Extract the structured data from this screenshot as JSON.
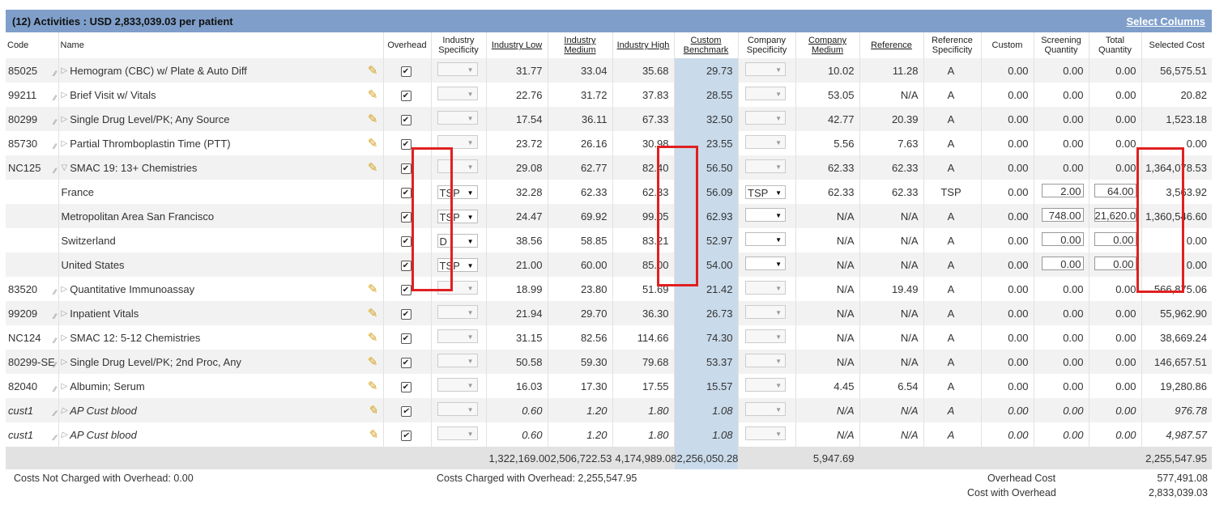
{
  "title": "(12) Activities : USD 2,833,039.03 per patient",
  "select_columns": "Select Columns",
  "columns": [
    "Code",
    "Name",
    "Overhead",
    "Industry Specificity",
    "Industry Low",
    "Industry Medium",
    "Industry High",
    "Custom Benchmark",
    "Company Specificity",
    "Company Medium",
    "Reference",
    "Reference Specificity",
    "Custom",
    "Screening Quantity",
    "Total Quantity",
    "Selected Cost"
  ],
  "rows": [
    {
      "code": "85025",
      "name": "Hemogram (CBC) w/ Plate & Auto Diff",
      "ind_spec": "",
      "low": "31.77",
      "med": "33.04",
      "high": "35.68",
      "bench": "29.73",
      "comp_spec": "",
      "comp_med": "10.02",
      "ref": "11.28",
      "ref_spec": "A",
      "custom": "0.00",
      "screen": "0.00",
      "total": "0.00",
      "cost": "56,575.51"
    },
    {
      "code": "99211",
      "name": "Brief Visit w/ Vitals",
      "ind_spec": "",
      "low": "22.76",
      "med": "31.72",
      "high": "37.83",
      "bench": "28.55",
      "comp_spec": "",
      "comp_med": "53.05",
      "ref": "N/A",
      "ref_spec": "A",
      "custom": "0.00",
      "screen": "0.00",
      "total": "0.00",
      "cost": "20.82"
    },
    {
      "code": "80299",
      "name": "Single Drug Level/PK; Any Source",
      "ind_spec": "",
      "low": "17.54",
      "med": "36.11",
      "high": "67.33",
      "bench": "32.50",
      "comp_spec": "",
      "comp_med": "42.77",
      "ref": "20.39",
      "ref_spec": "A",
      "custom": "0.00",
      "screen": "0.00",
      "total": "0.00",
      "cost": "1,523.18"
    },
    {
      "code": "85730",
      "name": "Partial Thromboplastin Time (PTT)",
      "ind_spec": "",
      "low": "23.72",
      "med": "26.16",
      "high": "30.98",
      "bench": "23.55",
      "comp_spec": "",
      "comp_med": "5.56",
      "ref": "7.63",
      "ref_spec": "A",
      "custom": "0.00",
      "screen": "0.00",
      "total": "0.00",
      "cost": "0.00"
    },
    {
      "code": "NC125",
      "name": "SMAC 19: 13+ Chemistries",
      "ind_spec": "",
      "low": "29.08",
      "med": "62.77",
      "high": "82.40",
      "bench": "56.50",
      "comp_spec": "",
      "comp_med": "62.33",
      "ref": "62.33",
      "ref_spec": "A",
      "custom": "0.00",
      "screen": "0.00",
      "total": "0.00",
      "cost": "1,364,078.53"
    },
    {
      "code": "",
      "name": "France",
      "ind_spec": "TSP",
      "low": "32.28",
      "med": "62.33",
      "high": "62.33",
      "bench": "56.09",
      "comp_spec": "TSP",
      "comp_med": "62.33",
      "ref": "62.33",
      "ref_spec": "TSP",
      "custom": "0.00",
      "screen": "2.00",
      "total": "64.00",
      "cost": "3,563.92"
    },
    {
      "code": "",
      "name": "Metropolitan Area San Francisco",
      "ind_spec": "TSP",
      "low": "24.47",
      "med": "69.92",
      "high": "99.05",
      "bench": "62.93",
      "comp_spec": "",
      "comp_med": "N/A",
      "ref": "N/A",
      "ref_spec": "A",
      "custom": "0.00",
      "screen": "748.00",
      "total": "21,620.0",
      "cost": "1,360,546.60"
    },
    {
      "code": "",
      "name": "Switzerland",
      "ind_spec": "D",
      "low": "38.56",
      "med": "58.85",
      "high": "83.21",
      "bench": "52.97",
      "comp_spec": "",
      "comp_med": "N/A",
      "ref": "N/A",
      "ref_spec": "A",
      "custom": "0.00",
      "screen": "0.00",
      "total": "0.00",
      "cost": "0.00"
    },
    {
      "code": "",
      "name": "United States",
      "ind_spec": "TSP",
      "low": "21.00",
      "med": "60.00",
      "high": "85.00",
      "bench": "54.00",
      "comp_spec": "",
      "comp_med": "N/A",
      "ref": "N/A",
      "ref_spec": "A",
      "custom": "0.00",
      "screen": "0.00",
      "total": "0.00",
      "cost": "0.00"
    },
    {
      "code": "83520",
      "name": "Quantitative Immunoassay",
      "ind_spec": "",
      "low": "18.99",
      "med": "23.80",
      "high": "51.69",
      "bench": "21.42",
      "comp_spec": "",
      "comp_med": "N/A",
      "ref": "19.49",
      "ref_spec": "A",
      "custom": "0.00",
      "screen": "0.00",
      "total": "0.00",
      "cost": "566,875.06"
    },
    {
      "code": "99209",
      "name": "Inpatient Vitals",
      "ind_spec": "",
      "low": "21.94",
      "med": "29.70",
      "high": "36.30",
      "bench": "26.73",
      "comp_spec": "",
      "comp_med": "N/A",
      "ref": "N/A",
      "ref_spec": "A",
      "custom": "0.00",
      "screen": "0.00",
      "total": "0.00",
      "cost": "55,962.90"
    },
    {
      "code": "NC124",
      "name": "SMAC 12: 5-12 Chemistries",
      "ind_spec": "",
      "low": "31.15",
      "med": "82.56",
      "high": "114.66",
      "bench": "74.30",
      "comp_spec": "",
      "comp_med": "N/A",
      "ref": "N/A",
      "ref_spec": "A",
      "custom": "0.00",
      "screen": "0.00",
      "total": "0.00",
      "cost": "38,669.24"
    },
    {
      "code": "80299-SE",
      "name": "Single Drug Level/PK; 2nd Proc, Any",
      "ind_spec": "",
      "low": "50.58",
      "med": "59.30",
      "high": "79.68",
      "bench": "53.37",
      "comp_spec": "",
      "comp_med": "N/A",
      "ref": "N/A",
      "ref_spec": "A",
      "custom": "0.00",
      "screen": "0.00",
      "total": "0.00",
      "cost": "146,657.51"
    },
    {
      "code": "82040",
      "name": "Albumin; Serum",
      "ind_spec": "",
      "low": "16.03",
      "med": "17.30",
      "high": "17.55",
      "bench": "15.57",
      "comp_spec": "",
      "comp_med": "4.45",
      "ref": "6.54",
      "ref_spec": "A",
      "custom": "0.00",
      "screen": "0.00",
      "total": "0.00",
      "cost": "19,280.86"
    },
    {
      "code": "cust1",
      "name": "AP Cust blood",
      "ind_spec": "",
      "low": "0.60",
      "med": "1.20",
      "high": "1.80",
      "bench": "1.08",
      "comp_spec": "",
      "comp_med": "N/A",
      "ref": "N/A",
      "ref_spec": "A",
      "custom": "0.00",
      "screen": "0.00",
      "total": "0.00",
      "cost": "976.78"
    },
    {
      "code": "cust1",
      "name": "AP Cust blood",
      "ind_spec": "",
      "low": "0.60",
      "med": "1.20",
      "high": "1.80",
      "bench": "1.08",
      "comp_spec": "",
      "comp_med": "N/A",
      "ref": "N/A",
      "ref_spec": "A",
      "custom": "0.00",
      "screen": "0.00",
      "total": "0.00",
      "cost": "4,987.57"
    }
  ],
  "totals": {
    "low": "1,322,169.00",
    "med": "2,506,722.53",
    "high": "4,174,989.08",
    "bench": "2,256,050.28",
    "comp_med": "5,947.69",
    "cost": "2,255,547.95"
  },
  "footer": {
    "not_charged": "Costs Not Charged with Overhead: 0.00",
    "charged": "Costs Charged with Overhead: 2,255,547.95",
    "overhead_label": "Overhead Cost",
    "overhead_value": "577,491.08",
    "with_overhead_label": "Cost with Overhead",
    "with_overhead_value": "2,833,039.03"
  },
  "accent_color": "#7f9fca",
  "highlight_color": "#e02020"
}
